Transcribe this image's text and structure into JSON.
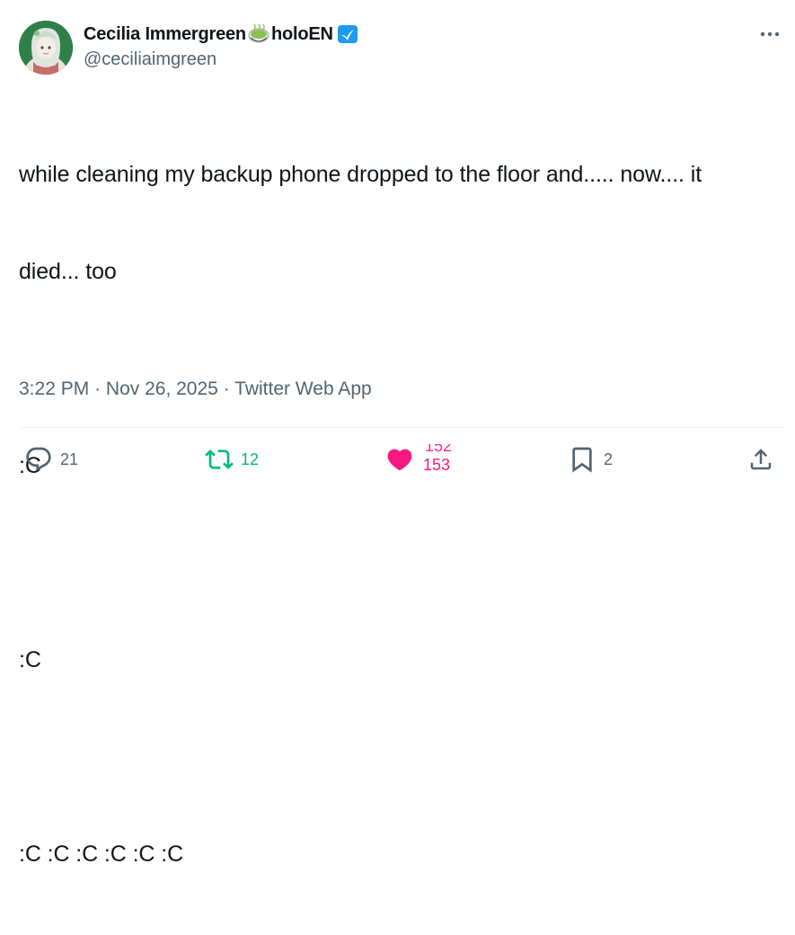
{
  "author": {
    "display_name": "Cecilia Immergreen",
    "emoji": "matcha-tea-icon",
    "name_suffix": "holoEN",
    "handle": "@ceciliaimgreen",
    "verified_color": "#1d9bf0"
  },
  "tweet": {
    "lines": [
      "while cleaning my backup phone dropped to the floor and..... now.... it",
      "died... too",
      "",
      ":C",
      "",
      ":C",
      "",
      ":C :C :C :C :C :C"
    ]
  },
  "meta": {
    "time": "3:22 PM",
    "separator": "·",
    "date": "Nov 26, 2025",
    "source": "Twitter Web App"
  },
  "actions": {
    "reply": {
      "icon": "reply-icon",
      "count": "21"
    },
    "retweet": {
      "icon": "retweet-icon",
      "count": "12",
      "color": "#00ba7c"
    },
    "like": {
      "icon": "heart-icon",
      "count_previous": "152",
      "count": "153",
      "color": "#f91880"
    },
    "bookmark": {
      "icon": "bookmark-icon",
      "count": "2"
    },
    "share": {
      "icon": "share-icon"
    }
  },
  "colors": {
    "text": "#0f1419",
    "secondary": "#536471",
    "divider": "#eff3f4"
  }
}
